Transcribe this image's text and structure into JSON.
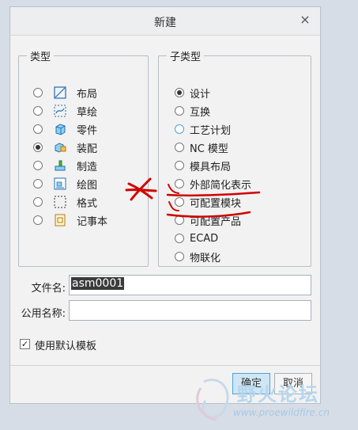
{
  "dialog": {
    "title": "新建",
    "close_icon": "×"
  },
  "type_group": {
    "legend": "类型",
    "items": [
      {
        "label": "布局",
        "icon": "layout-icon",
        "checked": false
      },
      {
        "label": "草绘",
        "icon": "sketch-icon",
        "checked": false
      },
      {
        "label": "零件",
        "icon": "part-icon",
        "checked": false
      },
      {
        "label": "装配",
        "icon": "assembly-icon",
        "checked": true
      },
      {
        "label": "制造",
        "icon": "manufacturing-icon",
        "checked": false
      },
      {
        "label": "绘图",
        "icon": "drawing-icon",
        "checked": false
      },
      {
        "label": "格式",
        "icon": "format-icon",
        "checked": false
      },
      {
        "label": "记事本",
        "icon": "notebook-icon",
        "checked": false
      }
    ]
  },
  "subtype_group": {
    "legend": "子类型",
    "items": [
      {
        "label": "设计",
        "checked": true
      },
      {
        "label": "互换",
        "checked": false
      },
      {
        "label": "工艺计划",
        "checked": false
      },
      {
        "label": "NC 模型",
        "checked": false
      },
      {
        "label": "模具布局",
        "checked": false
      },
      {
        "label": "外部简化表示",
        "checked": false
      },
      {
        "label": "可配置模块",
        "checked": false
      },
      {
        "label": "可配置产品",
        "checked": false
      },
      {
        "label": "ECAD",
        "checked": false
      },
      {
        "label": "物联化",
        "checked": false
      }
    ]
  },
  "form": {
    "filename_label": "文件名:",
    "filename_value": "asm0001",
    "common_name_label": "公用名称:",
    "common_name_value": "",
    "default_template_label": "使用默认模板",
    "default_template_checked": true
  },
  "buttons": {
    "ok": "确定",
    "cancel": "取消"
  },
  "watermark": {
    "text": "野火论坛",
    "url": "www.proewildfire.cn"
  },
  "colors": {
    "accent": "#4aa3d9",
    "annotation": "#d00000"
  }
}
